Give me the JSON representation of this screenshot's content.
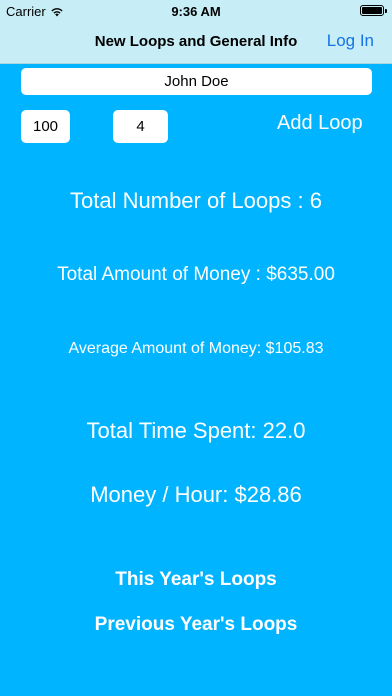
{
  "status_bar": {
    "carrier": "Carrier",
    "time": "9:36 AM"
  },
  "nav": {
    "title": "New Loops and General Info",
    "login_label": "Log In"
  },
  "form": {
    "name_value": "John Doe",
    "amount_value": "100",
    "hours_value": "4",
    "add_loop_label": "Add Loop"
  },
  "stats": {
    "total_loops": "Total Number of Loops : 6",
    "total_money": "Total Amount of Money : $635.00",
    "average_money": "Average Amount of Money: $105.83",
    "total_time": "Total Time Spent: 22.0",
    "money_per_hour": "Money / Hour: $28.86"
  },
  "links": {
    "this_year": "This Year's Loops",
    "previous_year": "Previous Year's Loops"
  },
  "colors": {
    "background": "#00b4ff",
    "nav_background": "#c7eef6",
    "accent": "#1673e6"
  },
  "icons": {
    "wifi": "wifi-icon",
    "battery": "battery-icon"
  }
}
